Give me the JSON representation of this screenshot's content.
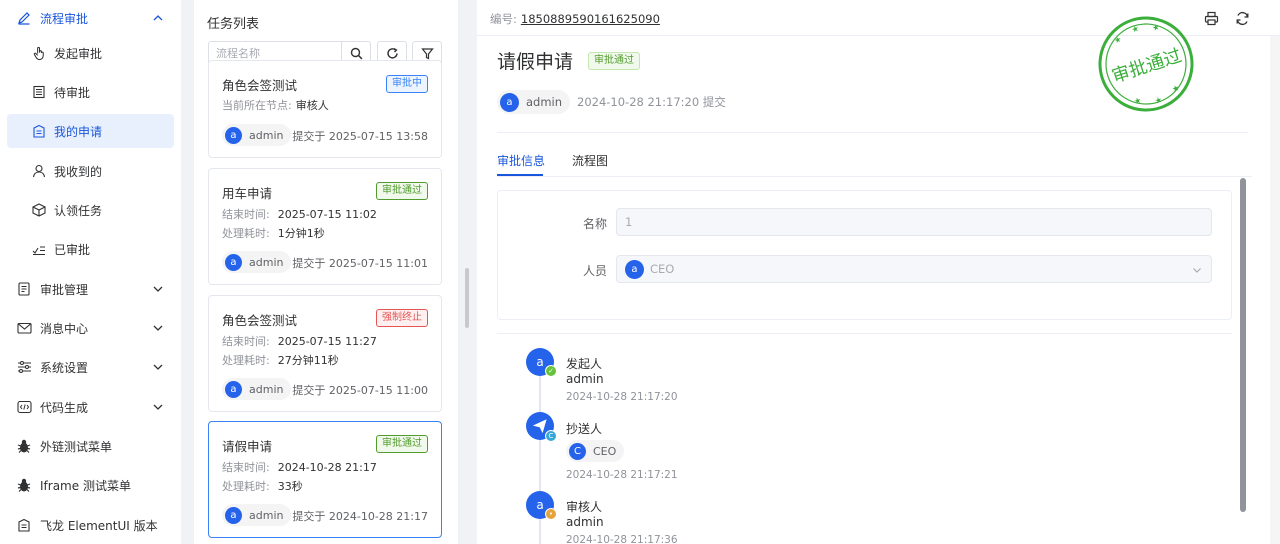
{
  "sidebar": {
    "group": {
      "label": "流程审批"
    },
    "sub_items": [
      {
        "label": "发起审批",
        "icon": "hand-pointer-icon"
      },
      {
        "label": "待审批",
        "icon": "list-doc-icon"
      },
      {
        "label": "我的申请",
        "icon": "building-doc-icon"
      },
      {
        "label": "我收到的",
        "icon": "user-icon"
      },
      {
        "label": "认领任务",
        "icon": "box-icon"
      },
      {
        "label": "已审批",
        "icon": "check-list-icon"
      }
    ],
    "items": [
      {
        "label": "审批管理",
        "icon": "document-icon"
      },
      {
        "label": "消息中心",
        "icon": "mail-icon"
      },
      {
        "label": "系统设置",
        "icon": "sliders-icon"
      },
      {
        "label": "代码生成",
        "icon": "code-icon"
      },
      {
        "label": "外链测试菜单",
        "icon": "bug-icon"
      },
      {
        "label": "Iframe 测试菜单",
        "icon": "bug-icon"
      },
      {
        "label": "飞龙 ElementUI 版本",
        "icon": "building-doc-icon"
      }
    ]
  },
  "task_list": {
    "title": "任务列表",
    "search_placeholder": "流程名称",
    "cards": [
      {
        "title": "角色会签测试",
        "tag": "审批中",
        "lines": [
          {
            "k": "当前所在节点:",
            "v": "审核人"
          }
        ],
        "user": "admin",
        "avatar": "a",
        "submitted": "提交于 2025-07-15 13:58"
      },
      {
        "title": "用车申请",
        "tag": "审批通过",
        "lines": [
          {
            "k": "结束时间:",
            "v": "2025-07-15 11:02"
          },
          {
            "k": "处理耗时:",
            "v": "1分钟1秒"
          }
        ],
        "user": "admin",
        "avatar": "a",
        "submitted": "提交于 2025-07-15 11:01"
      },
      {
        "title": "角色会签测试",
        "tag": "强制终止",
        "lines": [
          {
            "k": "结束时间:",
            "v": "2025-07-15 11:27"
          },
          {
            "k": "处理耗时:",
            "v": "27分钟11秒"
          }
        ],
        "user": "admin",
        "avatar": "a",
        "submitted": "提交于 2025-07-15 11:00"
      },
      {
        "title": "请假申请",
        "tag": "审批通过",
        "lines": [
          {
            "k": "结束时间:",
            "v": "2024-10-28 21:17"
          },
          {
            "k": "处理耗时:",
            "v": "33秒"
          }
        ],
        "user": "admin",
        "avatar": "a",
        "submitted": "提交于 2024-10-28 21:17"
      }
    ]
  },
  "detail": {
    "number_label": "编号:",
    "number": "1850889590161625090",
    "title": "请假申请",
    "status": "审批通过",
    "user": "admin",
    "avatar": "a",
    "submitted": "2024-10-28 21:17:20 提交",
    "stamp_text": "审批通过",
    "tabs": [
      "审批信息",
      "流程图"
    ],
    "form": {
      "name_label": "名称",
      "name_value": "1",
      "person_label": "人员",
      "person_value": "CEO",
      "person_avatar": "a"
    },
    "timeline": [
      {
        "role": "发起人",
        "name": "admin",
        "avatar": "a",
        "time": "2024-10-28 21:17:20"
      },
      {
        "role": "抄送人",
        "chip": "CEO",
        "chip_avatar": "C",
        "time": "2024-10-28 21:17:21"
      },
      {
        "role": "审核人",
        "name": "admin",
        "avatar": "a",
        "time": "2024-10-28 21:17:36"
      }
    ]
  },
  "colors": {
    "primary": "#1a56db",
    "success": "#529b2e",
    "danger": "#e45656",
    "stamp": "#3cae3c"
  }
}
